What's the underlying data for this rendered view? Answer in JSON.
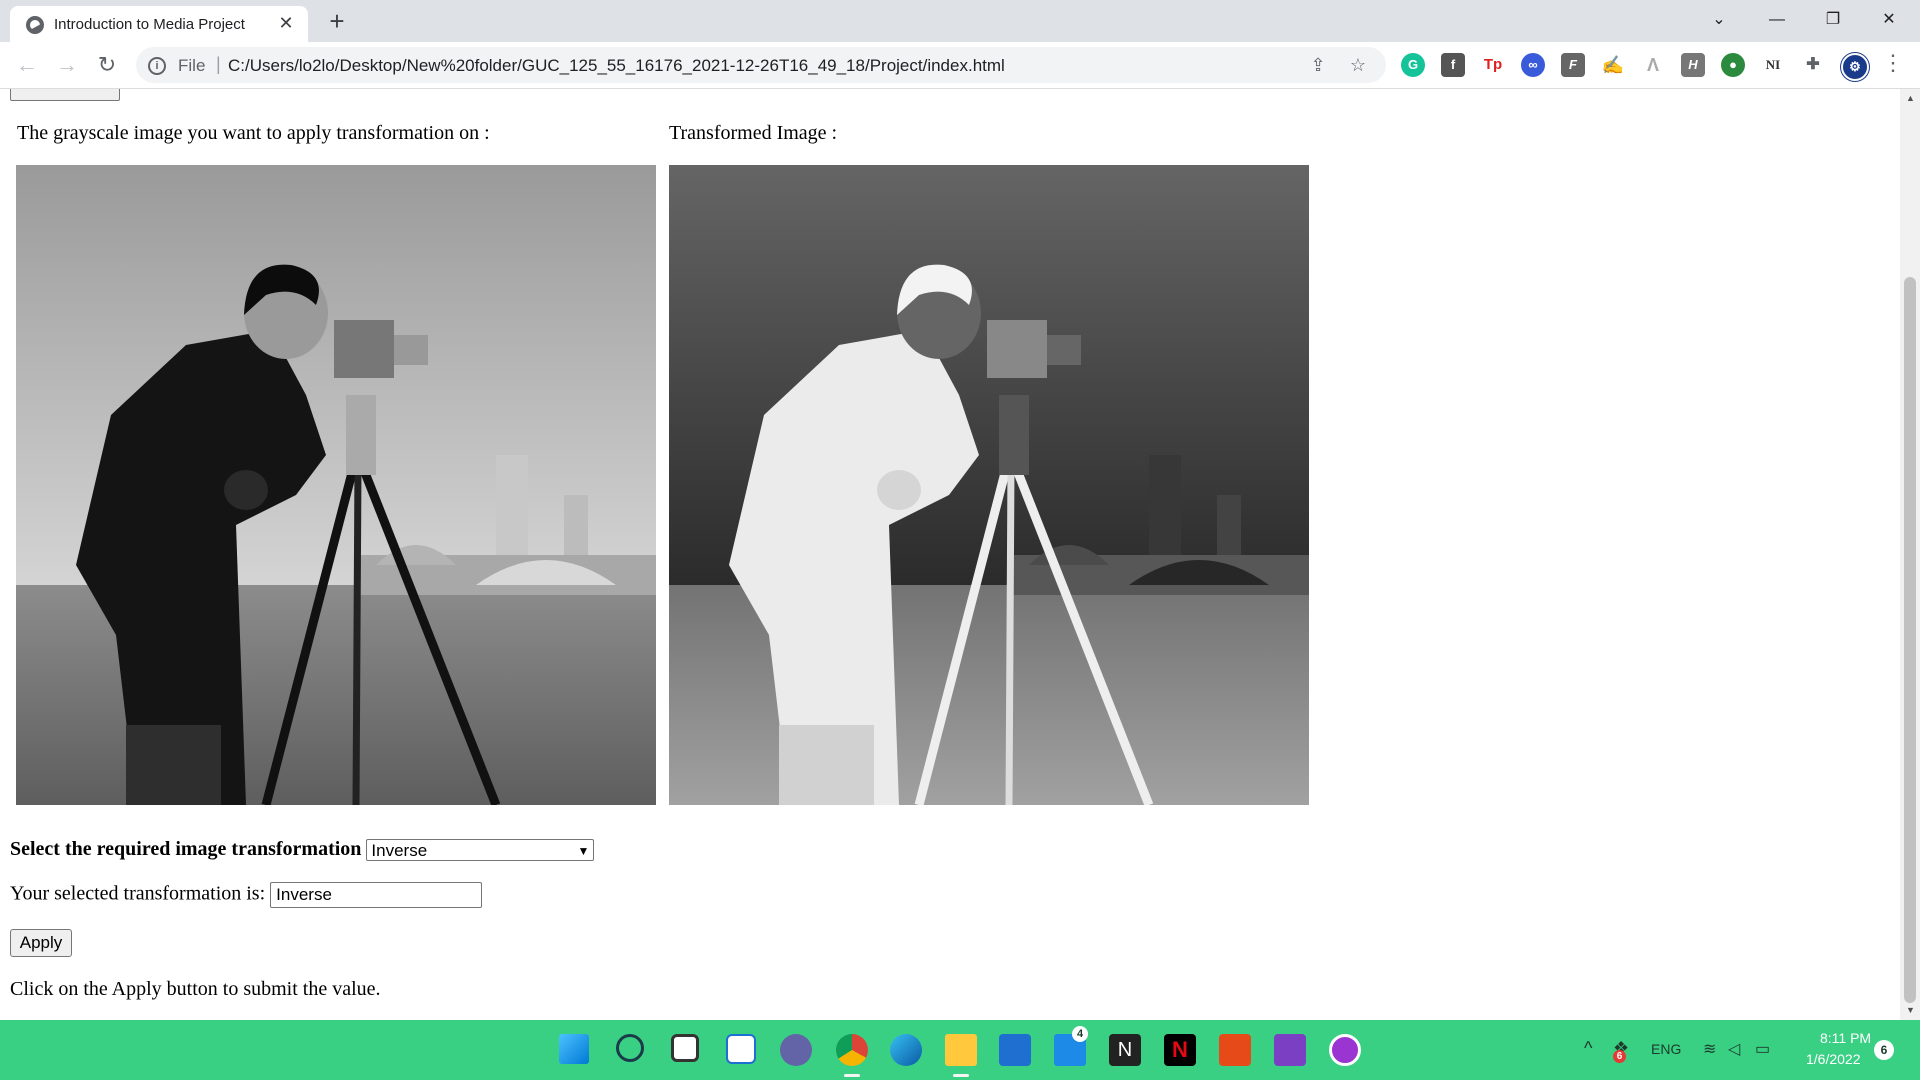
{
  "browser": {
    "tab_title": "Introduction to Media Project",
    "tab_close": "✕",
    "new_tab": "+",
    "url_scheme": "File",
    "url_separator": "|",
    "url": "C:/Users/lo2lo/Desktop/New%20folder/GUC_125_55_16176_2021-12-26T16_49_18/Project/index.html",
    "window_controls": {
      "minimize": "—",
      "maximize": "❐",
      "close": "✕",
      "tab_search": "⌄"
    },
    "nav": {
      "back": "←",
      "forward": "→",
      "reload": "↻"
    },
    "extensions": [
      "grammarly-icon",
      "f-extension-icon",
      "tp-extension-icon",
      "infinity-extension-icon",
      "f-italic-extension-icon",
      "cursive-extension-icon",
      "a-extension-icon",
      "h-extension-icon",
      "globe-extension-icon",
      "n-extension-icon",
      "puzzle-icon",
      "profile-icon"
    ],
    "extension_labels": {
      "f1": "f",
      "tp": "Tp",
      "inf": "∞",
      "f2": "F",
      "h": "H",
      "n": "NI",
      "puzzle": "✚"
    }
  },
  "page": {
    "original_caption": "The grayscale image you want to apply transformation on :",
    "transformed_caption": "Transformed Image :",
    "select_label": "Select the required image transformation",
    "select_value": "Inverse",
    "selected_label": "Your selected transformation is:",
    "selected_value": "Inverse",
    "apply_button": "Apply",
    "instruction": "Click on the Apply button to submit the value."
  },
  "taskbar": {
    "apps": [
      "windows-start-icon",
      "search-icon",
      "task-view-icon",
      "widgets-icon",
      "teams-chat-icon",
      "chrome-icon",
      "edge-icon",
      "file-explorer-icon",
      "microsoft-store-icon",
      "mail-icon",
      "notion-icon",
      "netflix-icon",
      "office-icon",
      "visual-studio-icon",
      "podcast-app-icon"
    ],
    "mail_badge": "4",
    "tray": {
      "chevron": "^",
      "language": "ENG",
      "time": "8:11 PM",
      "date": "1/6/2022",
      "notification_count": "6",
      "dropbox_badge": "6"
    }
  },
  "colors": {
    "taskbar": "#3ad083",
    "tab_strip": "#dee1e6"
  }
}
